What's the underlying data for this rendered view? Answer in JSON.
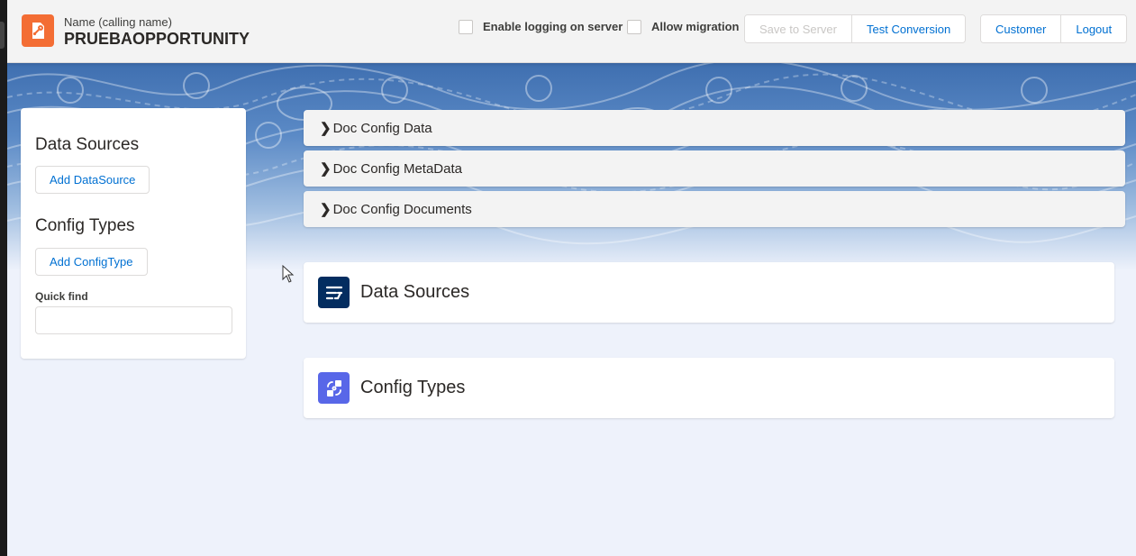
{
  "header": {
    "title_label": "Name (calling name)",
    "title_value": "PRUEBAOPPORTUNITY",
    "logo_icon": "document-wrench-icon",
    "brand_color": "#f36d34",
    "checkboxes": [
      {
        "label": "Enable logging on server",
        "checked": false
      },
      {
        "label": "Allow migration",
        "checked": false
      }
    ],
    "actions": {
      "save_to_server": "Save to Server",
      "test_conversion": "Test Conversion"
    },
    "user": {
      "customer": "Customer",
      "logout": "Logout"
    }
  },
  "sidebar": {
    "data_sources_heading": "Data Sources",
    "add_datasource": "Add DataSource",
    "config_types_heading": "Config Types",
    "add_configtype": "Add ConfigType",
    "quick_find_label": "Quick find",
    "quick_find_value": ""
  },
  "accordion": [
    {
      "label": "Doc Config Data",
      "expanded": false
    },
    {
      "label": "Doc Config MetaData",
      "expanded": false
    },
    {
      "label": "Doc Config Documents",
      "expanded": false
    }
  ],
  "cards": [
    {
      "title": "Data Sources",
      "icon": "flow-icon",
      "icon_color": "#032d60"
    },
    {
      "title": "Config Types",
      "icon": "shuffle-icon",
      "icon_color": "#5867e8"
    }
  ],
  "link_color": "#0070d2"
}
